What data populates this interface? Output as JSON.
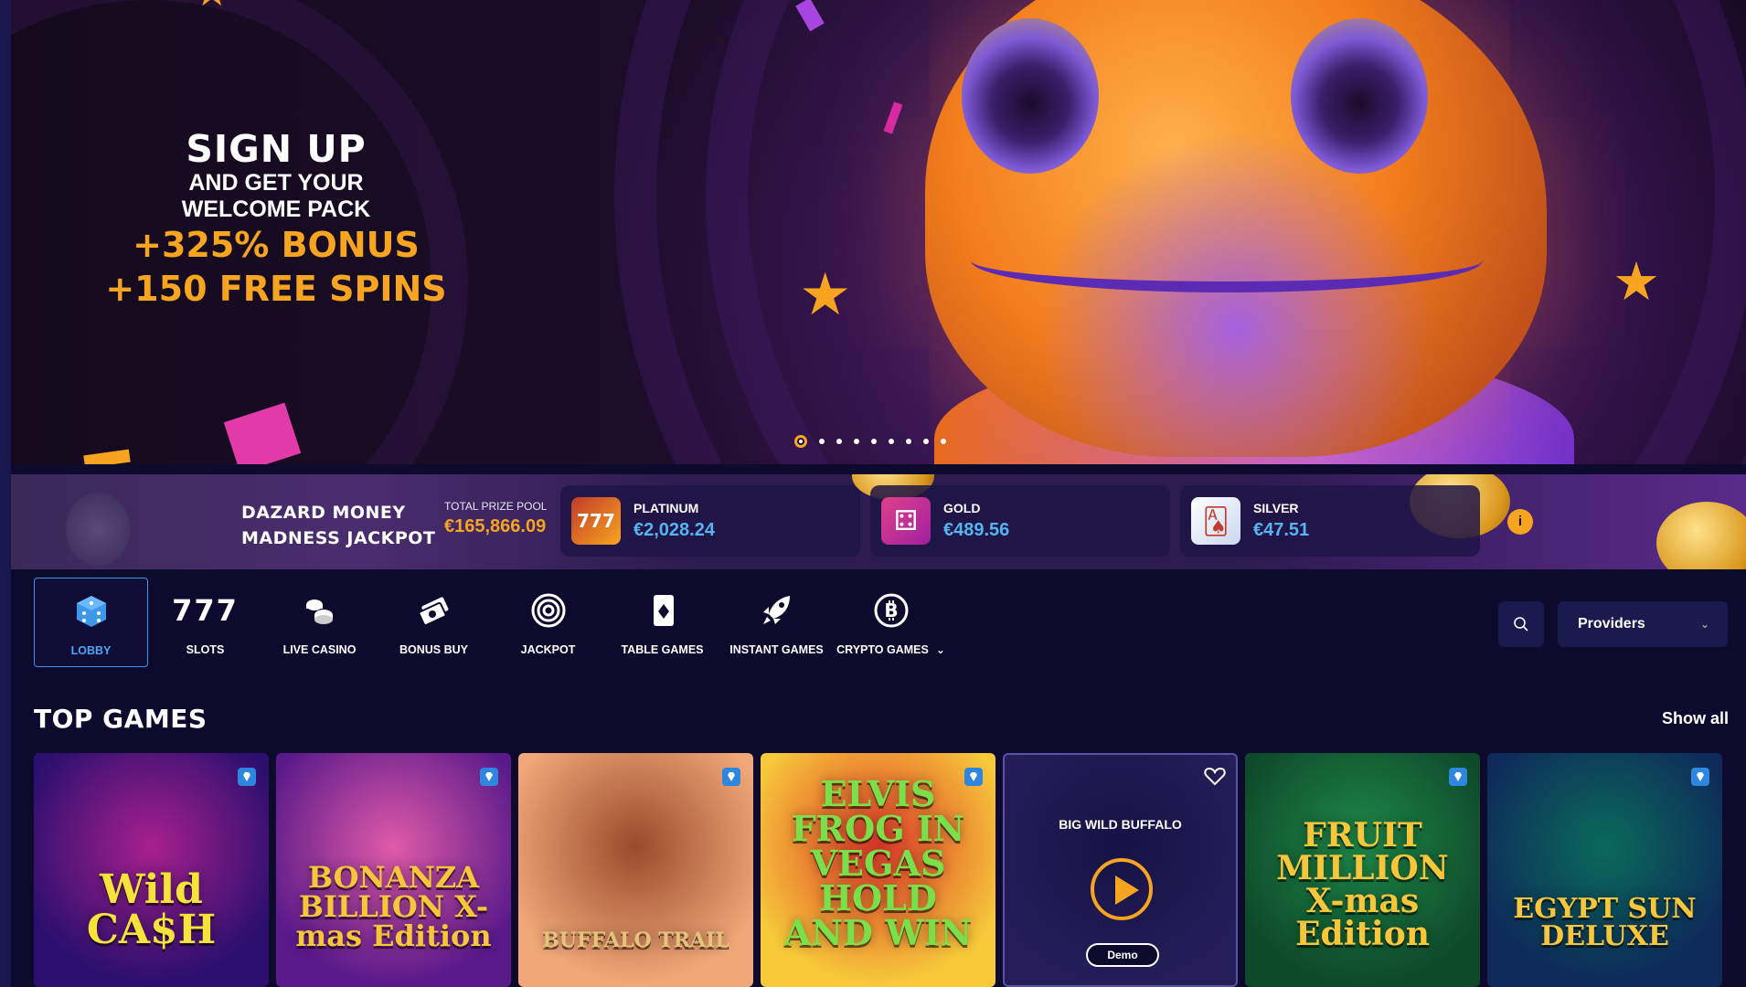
{
  "hero": {
    "title": "SIGN UP",
    "subtitle_line1": "AND GET YOUR",
    "subtitle_line2": "WELCOME PACK",
    "bonus_line1": "+325% BONUS",
    "bonus_line2": "+150 FREE SPINS",
    "slides_total": 9,
    "active_slide": 1
  },
  "jackpot": {
    "title_line1": "DAZARD MONEY",
    "title_line2": "MADNESS JACKPOT",
    "pool_label": "TOTAL PRIZE POOL",
    "pool_value": "€165,866.09",
    "tiers": [
      {
        "name": "PLATINUM",
        "value": "€2,028.24",
        "icon": "slot-777-icon"
      },
      {
        "name": "GOLD",
        "value": "€489.56",
        "icon": "dice-icon"
      },
      {
        "name": "SILVER",
        "value": "€47.51",
        "icon": "cards-icon"
      }
    ],
    "info_label": "i"
  },
  "categories": [
    {
      "label": "LOBBY",
      "icon": "dice-icon",
      "active": true
    },
    {
      "label": "SLOTS",
      "icon": "777",
      "active": false
    },
    {
      "label": "LIVE CASINO",
      "icon": "live-casino-icon",
      "active": false
    },
    {
      "label": "BONUS BUY",
      "icon": "bonus-buy-icon",
      "active": false
    },
    {
      "label": "JACKPOT",
      "icon": "target-icon",
      "active": false
    },
    {
      "label": "TABLE GAMES",
      "icon": "playing-card-icon",
      "active": false
    },
    {
      "label": "INSTANT GAMES",
      "icon": "rocket-icon",
      "active": false
    },
    {
      "label": "CRYPTO GAMES",
      "icon": "bitcoin-icon",
      "active": false
    }
  ],
  "providers_label": "Providers",
  "top_games": {
    "title": "TOP GAMES",
    "show_all": "Show all",
    "games": [
      {
        "title": "Wild CA$H",
        "colors": [
          "#2a0f6e",
          "#a8208e"
        ],
        "accent": "#f5e23a"
      },
      {
        "title": "BONANZA BILLION X-mas Edition",
        "colors": [
          "#5a1a8a",
          "#e05aa8"
        ],
        "accent": "#f7c63a"
      },
      {
        "title": "BUFFALO TRAIL",
        "colors": [
          "#f0a878",
          "#9a4a2a"
        ],
        "accent": "#e8c27a"
      },
      {
        "title": "ELVIS FROG IN VEGAS HOLD AND WIN",
        "colors": [
          "#f6c93a",
          "#e0392a"
        ],
        "accent": "#7ae04a"
      },
      {
        "title": "BIG WILD BUFFALO",
        "colors": [
          "#3a2c7a",
          "#1a1650"
        ],
        "accent": "#7a6ad6",
        "hover": true,
        "demo_label": "Demo"
      },
      {
        "title": "FRUIT MILLION X-mas Edition",
        "colors": [
          "#0e4a2a",
          "#1f8a4a"
        ],
        "accent": "#f7c63a"
      },
      {
        "title": "EGYPT SUN DELUXE",
        "colors": [
          "#0e2a5a",
          "#0a6a5a"
        ],
        "accent": "#f7c63a"
      }
    ]
  }
}
